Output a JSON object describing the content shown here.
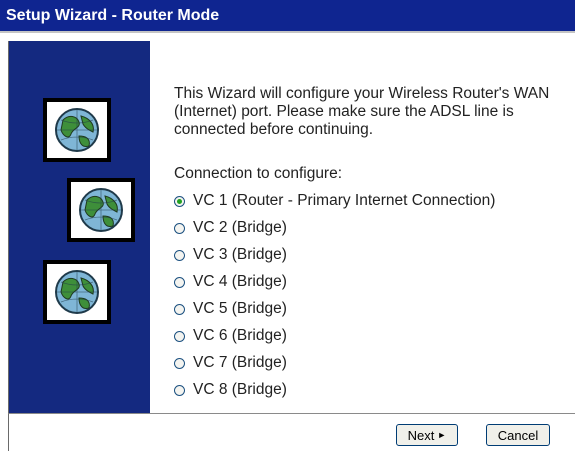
{
  "window": {
    "title": "Setup Wizard - Router Mode"
  },
  "content": {
    "intro": "This Wizard will configure your Wireless Router's WAN (Internet) port. Please make sure the ADSL line is connected before continuing.",
    "section_label": "Connection to configure:",
    "options": [
      {
        "label": "VC 1 (Router - Primary Internet Connection)",
        "selected": true
      },
      {
        "label": "VC 2 (Bridge)",
        "selected": false
      },
      {
        "label": "VC 3 (Bridge)",
        "selected": false
      },
      {
        "label": "VC 4 (Bridge)",
        "selected": false
      },
      {
        "label": "VC 5 (Bridge)",
        "selected": false
      },
      {
        "label": "VC 6 (Bridge)",
        "selected": false
      },
      {
        "label": "VC 7 (Bridge)",
        "selected": false
      },
      {
        "label": "VC 8 (Bridge)",
        "selected": false
      }
    ]
  },
  "footer": {
    "next_label": "Next",
    "next_icon": "chevron-right-icon",
    "cancel_label": "Cancel"
  },
  "sidebar": {
    "icons": [
      "globe-icon",
      "globe-icon",
      "globe-icon"
    ]
  },
  "colors": {
    "titlebar": "#0f2590",
    "sidebar": "#142980",
    "radio_selected": "#21a121"
  }
}
